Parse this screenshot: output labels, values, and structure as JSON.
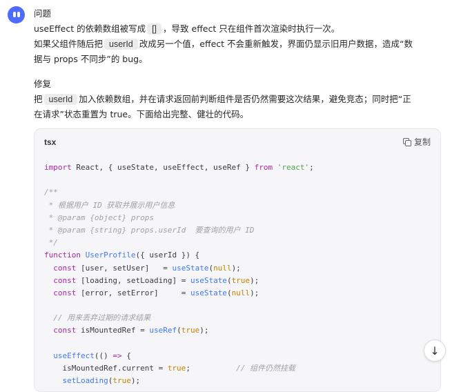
{
  "issue": {
    "heading": "问题",
    "line1_pre": "useEffect 的依赖数组被写成",
    "line1_code": "[]",
    "line1_post": "，导致 effect 只在组件首次渲染时执行一次。",
    "line2_pre": "如果父组件随后把",
    "line2_code": "userId",
    "line2_post": "改成另一个值，effect 不会重新触发，界面仍显示旧用户数据，造成“数",
    "line3": "据与 props 不同步”的 bug。"
  },
  "fix": {
    "heading": "修复",
    "line1_pre": "把",
    "line1_code": "userId",
    "line1_post": "加入依赖数组，并在请求返回前判断组件是否仍然需要这次结果，避免竞态；同时把“正",
    "line2": "在请求”状态重置为 true。下面给出完整、健壮的代码。"
  },
  "codeblock": {
    "language": "tsx",
    "copy_label": "复制",
    "lines": [
      [
        {
          "t": "import",
          "c": "kw"
        },
        {
          "t": " React, { useState, useEffect, useRef } "
        },
        {
          "t": "from",
          "c": "kw"
        },
        {
          "t": " "
        },
        {
          "t": "'react'",
          "c": "str"
        },
        {
          "t": ";"
        }
      ],
      [],
      [
        {
          "t": "/**",
          "c": "cm"
        }
      ],
      [
        {
          "t": " * 根据用户 ID 获取并展示用户信息",
          "c": "cm"
        }
      ],
      [
        {
          "t": " * @param {object} props",
          "c": "cm"
        }
      ],
      [
        {
          "t": " * @param {string} props.userId  要查询的用户 ID",
          "c": "cm"
        }
      ],
      [
        {
          "t": " */",
          "c": "cm"
        }
      ],
      [
        {
          "t": "function",
          "c": "kw"
        },
        {
          "t": " "
        },
        {
          "t": "UserProfile",
          "c": "fn"
        },
        {
          "t": "({ userId }) {"
        }
      ],
      [
        {
          "t": "  "
        },
        {
          "t": "const",
          "c": "kw"
        },
        {
          "t": " [user, setUser]   = "
        },
        {
          "t": "useState",
          "c": "fn"
        },
        {
          "t": "("
        },
        {
          "t": "null",
          "c": "lit"
        },
        {
          "t": ");"
        }
      ],
      [
        {
          "t": "  "
        },
        {
          "t": "const",
          "c": "kw"
        },
        {
          "t": " [loading, setLoading] = "
        },
        {
          "t": "useState",
          "c": "fn"
        },
        {
          "t": "("
        },
        {
          "t": "true",
          "c": "lit"
        },
        {
          "t": ");"
        }
      ],
      [
        {
          "t": "  "
        },
        {
          "t": "const",
          "c": "kw"
        },
        {
          "t": " [error, setError]     = "
        },
        {
          "t": "useState",
          "c": "fn"
        },
        {
          "t": "("
        },
        {
          "t": "null",
          "c": "lit"
        },
        {
          "t": ");"
        }
      ],
      [],
      [
        {
          "t": "  // 用来丢弃过期的请求结果",
          "c": "cm"
        }
      ],
      [
        {
          "t": "  "
        },
        {
          "t": "const",
          "c": "kw"
        },
        {
          "t": " isMountedRef = "
        },
        {
          "t": "useRef",
          "c": "fn"
        },
        {
          "t": "("
        },
        {
          "t": "true",
          "c": "lit"
        },
        {
          "t": ");"
        }
      ],
      [],
      [
        {
          "t": "  "
        },
        {
          "t": "useEffect",
          "c": "fn"
        },
        {
          "t": "(() "
        },
        {
          "t": "=>",
          "c": "kw"
        },
        {
          "t": " {"
        }
      ],
      [
        {
          "t": "    isMountedRef.current = "
        },
        {
          "t": "true",
          "c": "lit"
        },
        {
          "t": ";          "
        },
        {
          "t": "// 组件仍然挂载",
          "c": "cm"
        }
      ],
      [
        {
          "t": "    "
        },
        {
          "t": "setLoading",
          "c": "fn"
        },
        {
          "t": "("
        },
        {
          "t": "true",
          "c": "lit"
        },
        {
          "t": ");"
        }
      ]
    ]
  },
  "scroll_down": {
    "icon": "↓"
  }
}
